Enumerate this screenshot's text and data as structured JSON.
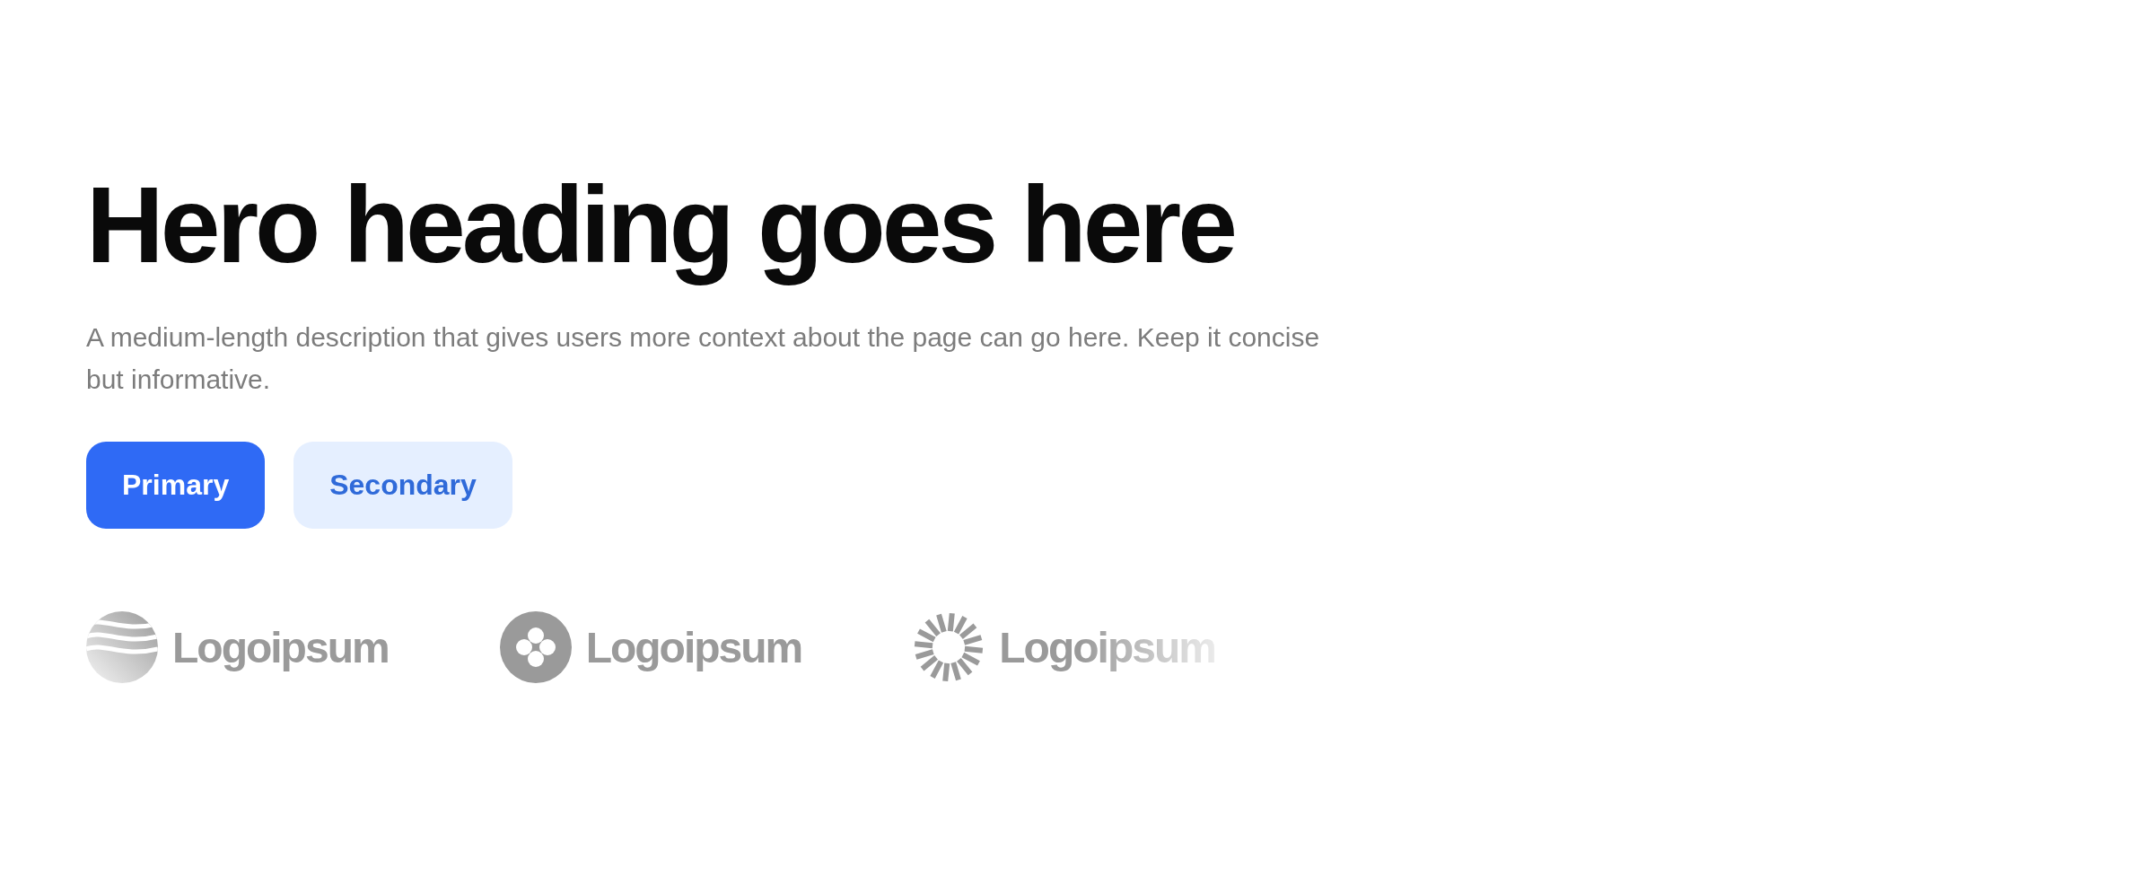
{
  "hero": {
    "heading": "Hero heading goes here",
    "description": "A medium-length description that gives users more context about the page can go here. Keep it concise but informative."
  },
  "buttons": [
    {
      "label": "Primary",
      "kind": "primary"
    },
    {
      "label": "Secondary",
      "kind": "secondary"
    }
  ],
  "logos": [
    {
      "name": "Logoipsum",
      "kind": "waves"
    },
    {
      "name": "Logoipsum",
      "kind": "clover"
    },
    {
      "name": "Logoipsum",
      "kind": "burst"
    }
  ]
}
